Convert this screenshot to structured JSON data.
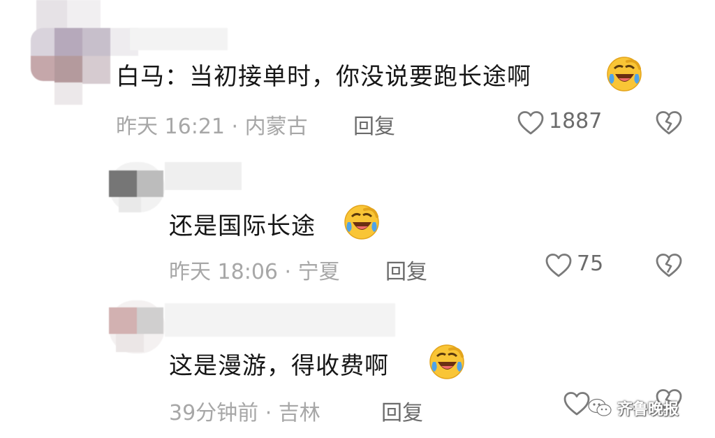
{
  "comments": [
    {
      "text": "白马：当初接单时，你没说要跑长途啊",
      "meta": "昨天 16:21 · 内蒙古",
      "reply_label": "回复",
      "likes": "1887"
    },
    {
      "text": "还是国际长途",
      "meta": "昨天 18:06 · 宁夏",
      "reply_label": "回复",
      "likes": "75"
    },
    {
      "text": "这是漫游，得收费啊",
      "meta": "39分钟前 · 吉林",
      "reply_label": "回复",
      "likes": ""
    }
  ],
  "emoji_name": "laugh-cry-emoji",
  "watermark": {
    "text": "齐鲁晚报",
    "icon": "wechat-icon"
  },
  "colors": {
    "text": "#161616",
    "meta": "#a7a7a7",
    "action": "#6b6b6b"
  }
}
